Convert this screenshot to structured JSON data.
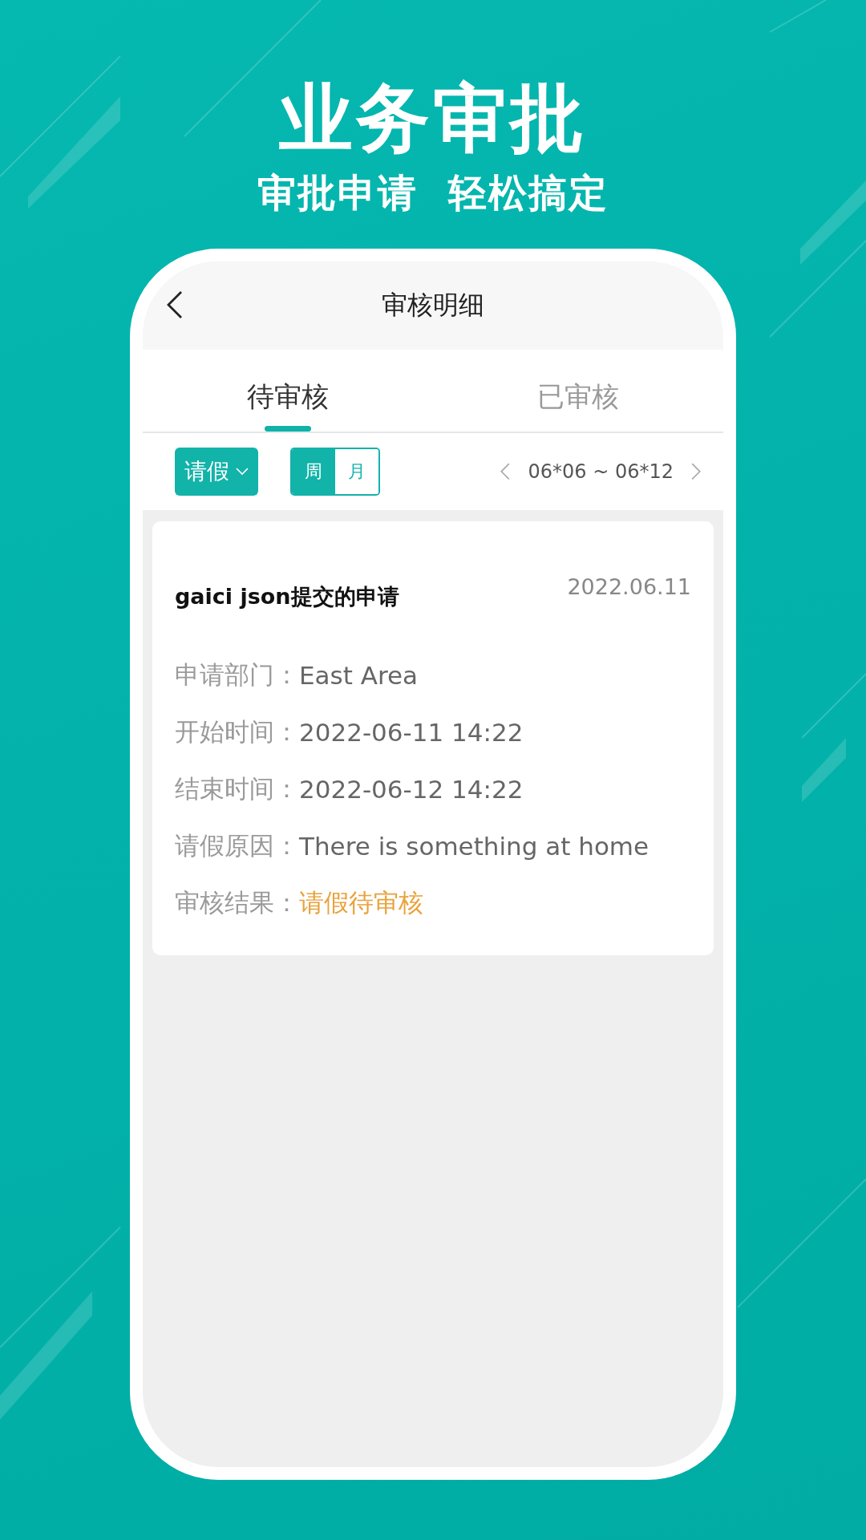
{
  "headline": "业务审批",
  "subheadline": "审批申请  轻松搞定",
  "nav": {
    "title": "审核明细"
  },
  "tabs": [
    {
      "label": "待审核",
      "selected": true
    },
    {
      "label": "已审核",
      "selected": false
    }
  ],
  "filter": {
    "type_dropdown": "请假",
    "period_options": [
      {
        "label": "周",
        "selected": true
      },
      {
        "label": "月",
        "selected": false
      }
    ],
    "date_range": "06*06 ~ 06*12"
  },
  "records": [
    {
      "title": "gaici json提交的申请",
      "date": "2022.06.11",
      "fields": [
        {
          "label": "申请部门：",
          "value": "East Area",
          "kind": "plain"
        },
        {
          "label": "开始时间：",
          "value": "2022-06-11 14:22",
          "kind": "plain"
        },
        {
          "label": "结束时间：",
          "value": "2022-06-12 14:22",
          "kind": "plain"
        },
        {
          "label": "请假原因：",
          "value": "There is something at home",
          "kind": "plain"
        },
        {
          "label": "审核结果：",
          "value": "请假待审核",
          "kind": "status"
        }
      ]
    }
  ]
}
